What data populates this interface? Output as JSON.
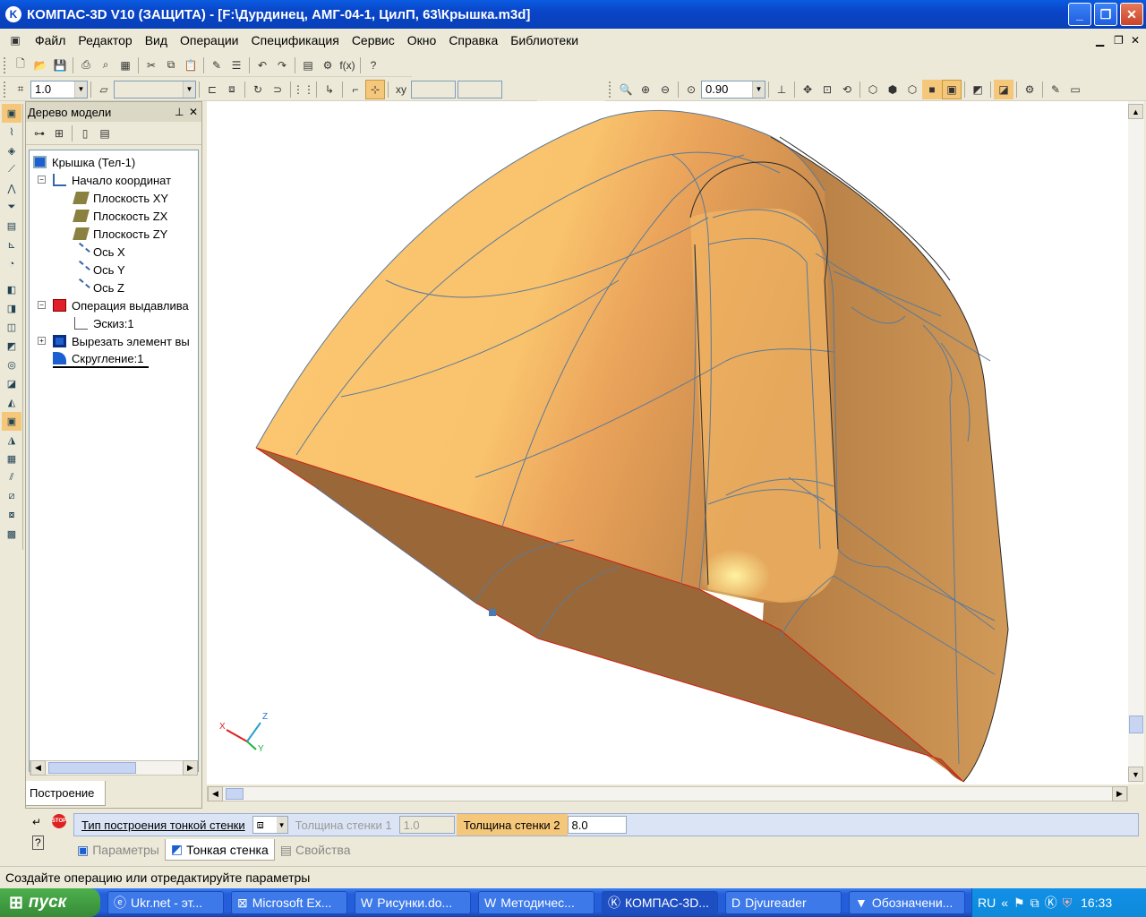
{
  "window": {
    "title": "КОМПАС-3D V10 (ЗАЩИТА) - [F:\\Дурдинец, АМГ-04-1, ЦилП, 63\\Крышка.m3d]"
  },
  "menu": [
    "Файл",
    "Редактор",
    "Вид",
    "Операции",
    "Спецификация",
    "Сервис",
    "Окно",
    "Справка",
    "Библиотеки"
  ],
  "toolbar": {
    "step_value": "1.0",
    "zoom_value": "0.90"
  },
  "tree": {
    "header": "Дерево модели",
    "tab": "Построение",
    "nodes": [
      "Крышка (Тел-1)",
      "Начало координат",
      "Плоскость XY",
      "Плоскость ZX",
      "Плоскость ZY",
      "Ось X",
      "Ось Y",
      "Ось Z",
      "Операция выдавлива",
      "Эскиз:1",
      "Вырезать элемент вы",
      "Скругление:1"
    ]
  },
  "axes": {
    "x": "X",
    "y": "Y",
    "z": "Z"
  },
  "props": {
    "build_type_label": "Тип построения тонкой стенки",
    "thickness1_label": "Толщина стенки 1",
    "thickness1_value": "1.0",
    "thickness2_label": "Толщина стенки 2",
    "thickness2_value": "8.0",
    "tabs": [
      "Параметры",
      "Тонкая стенка",
      "Свойства"
    ],
    "stop_label": "STOP"
  },
  "status": "Создайте операцию или отредактируйте параметры",
  "taskbar": {
    "start": "пуск",
    "tasks": [
      "Ukr.net - эт...",
      "Microsoft Ex...",
      "Рисунки.do...",
      "Методичес...",
      "КОМПАС-3D...",
      "Djvureader",
      "Обозначени..."
    ],
    "lang": "RU",
    "clock": "16:33"
  },
  "colors": {
    "model_light": "#fdc873",
    "model_dark": "#9b6a38",
    "title_blue": "#0a45c8"
  }
}
